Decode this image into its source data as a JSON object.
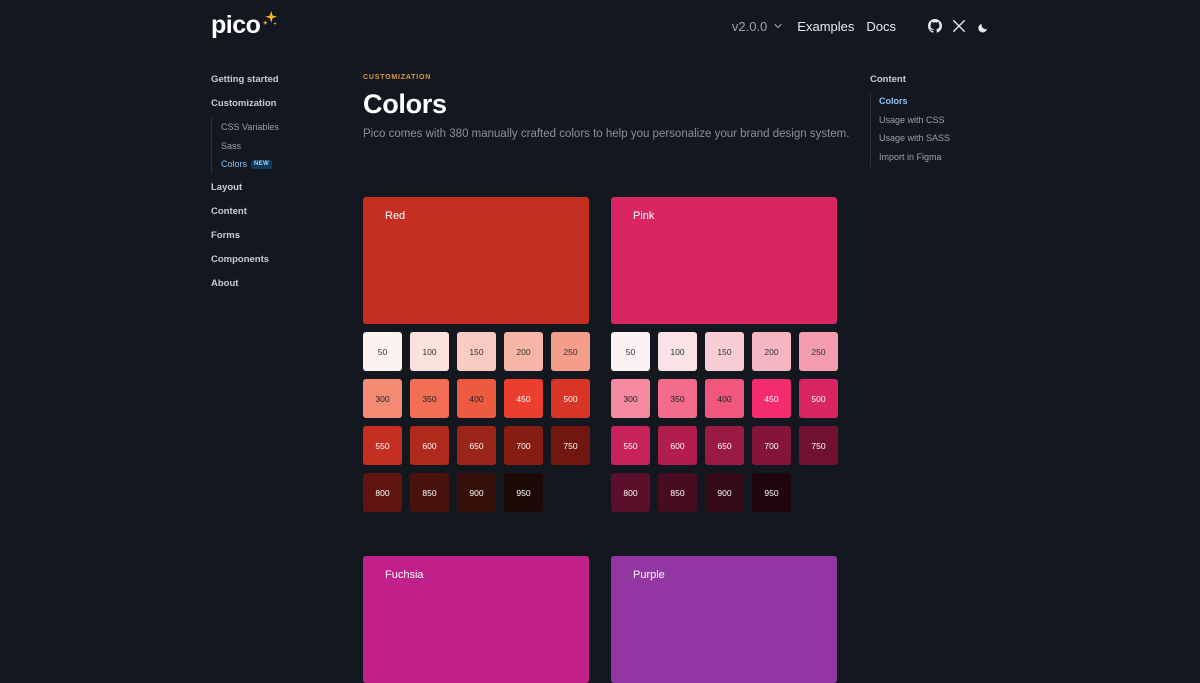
{
  "header": {
    "logo_text": "pico",
    "logo_icon": "sparkles-icon",
    "version_label": "v2.0.0",
    "nav_links": [
      "Examples",
      "Docs"
    ],
    "icons": [
      "github-icon",
      "x-twitter-icon",
      "moon-icon"
    ]
  },
  "sidebar": {
    "getting_started": "Getting started",
    "customization": "Customization",
    "customization_items": [
      {
        "label": "CSS Variables"
      },
      {
        "label": "Sass"
      },
      {
        "label": "Colors",
        "badge": "NEW"
      }
    ],
    "layout": "Layout",
    "content": "Content",
    "forms": "Forms",
    "components": "Components",
    "about": "About"
  },
  "main": {
    "eyebrow": "CUSTOMIZATION",
    "title": "Colors",
    "description": "Pico comes with 380 manually crafted colors to help you personalize your brand design system."
  },
  "toc": {
    "title": "Content",
    "items": [
      "Colors",
      "Usage with CSS",
      "Usage with SASS",
      "Import in Figma"
    ]
  },
  "palettes": [
    {
      "name": "Red",
      "main_color": "#c52f21",
      "swatches": [
        {
          "label": "50",
          "color": "#fcf2f0",
          "text": "#333333"
        },
        {
          "label": "100",
          "color": "#fbe2dc",
          "text": "#333333"
        },
        {
          "label": "150",
          "color": "#f8ccc2",
          "text": "#333333"
        },
        {
          "label": "200",
          "color": "#f6b5a6",
          "text": "#333333"
        },
        {
          "label": "250",
          "color": "#f49d8a",
          "text": "#333333"
        },
        {
          "label": "300",
          "color": "#f48b74",
          "text": "#222222"
        },
        {
          "label": "350",
          "color": "#f26e55",
          "text": "#222222"
        },
        {
          "label": "400",
          "color": "#ee5a40",
          "text": "#222222"
        },
        {
          "label": "450",
          "color": "#ec3e2c",
          "text": "#ffffff"
        },
        {
          "label": "500",
          "color": "#d93526",
          "text": "#ffffff"
        },
        {
          "label": "550",
          "color": "#c52f21",
          "text": "#ffffff"
        },
        {
          "label": "600",
          "color": "#af291d",
          "text": "#ffffff"
        },
        {
          "label": "650",
          "color": "#9b2519",
          "text": "#ffffff"
        },
        {
          "label": "700",
          "color": "#861d13",
          "text": "#ffffff"
        },
        {
          "label": "750",
          "color": "#72170f",
          "text": "#ffffff"
        },
        {
          "label": "800",
          "color": "#5f150f",
          "text": "#ffffff"
        },
        {
          "label": "850",
          "color": "#4a120c",
          "text": "#ffffff"
        },
        {
          "label": "900",
          "color": "#350f0a",
          "text": "#ffffff"
        },
        {
          "label": "950",
          "color": "#1d0906",
          "text": "#ffffff"
        }
      ]
    },
    {
      "name": "Pink",
      "main_color": "#d92662",
      "swatches": [
        {
          "label": "50",
          "color": "#fcf2f4",
          "text": "#333333"
        },
        {
          "label": "100",
          "color": "#fbe2e6",
          "text": "#333333"
        },
        {
          "label": "150",
          "color": "#f8cdd6",
          "text": "#333333"
        },
        {
          "label": "200",
          "color": "#f6b5c3",
          "text": "#333333"
        },
        {
          "label": "250",
          "color": "#f49cb0",
          "text": "#333333"
        },
        {
          "label": "300",
          "color": "#f58aa0",
          "text": "#222222"
        },
        {
          "label": "350",
          "color": "#f46c8c",
          "text": "#222222"
        },
        {
          "label": "400",
          "color": "#f1567c",
          "text": "#222222"
        },
        {
          "label": "450",
          "color": "#f42c6f",
          "text": "#ffffff"
        },
        {
          "label": "500",
          "color": "#d92662",
          "text": "#ffffff"
        },
        {
          "label": "550",
          "color": "#c72259",
          "text": "#ffffff"
        },
        {
          "label": "600",
          "color": "#b11e4e",
          "text": "#ffffff"
        },
        {
          "label": "650",
          "color": "#9a1a44",
          "text": "#ffffff"
        },
        {
          "label": "700",
          "color": "#83153a",
          "text": "#ffffff"
        },
        {
          "label": "750",
          "color": "#6f1232",
          "text": "#ffffff"
        },
        {
          "label": "800",
          "color": "#5b0f2a",
          "text": "#ffffff"
        },
        {
          "label": "850",
          "color": "#470c20",
          "text": "#ffffff"
        },
        {
          "label": "900",
          "color": "#340918",
          "text": "#ffffff"
        },
        {
          "label": "950",
          "color": "#1f050e",
          "text": "#ffffff"
        }
      ]
    },
    {
      "name": "Fuchsia",
      "main_color": "#c1208b",
      "swatches": []
    },
    {
      "name": "Purple",
      "main_color": "#9236a4",
      "swatches": []
    }
  ]
}
